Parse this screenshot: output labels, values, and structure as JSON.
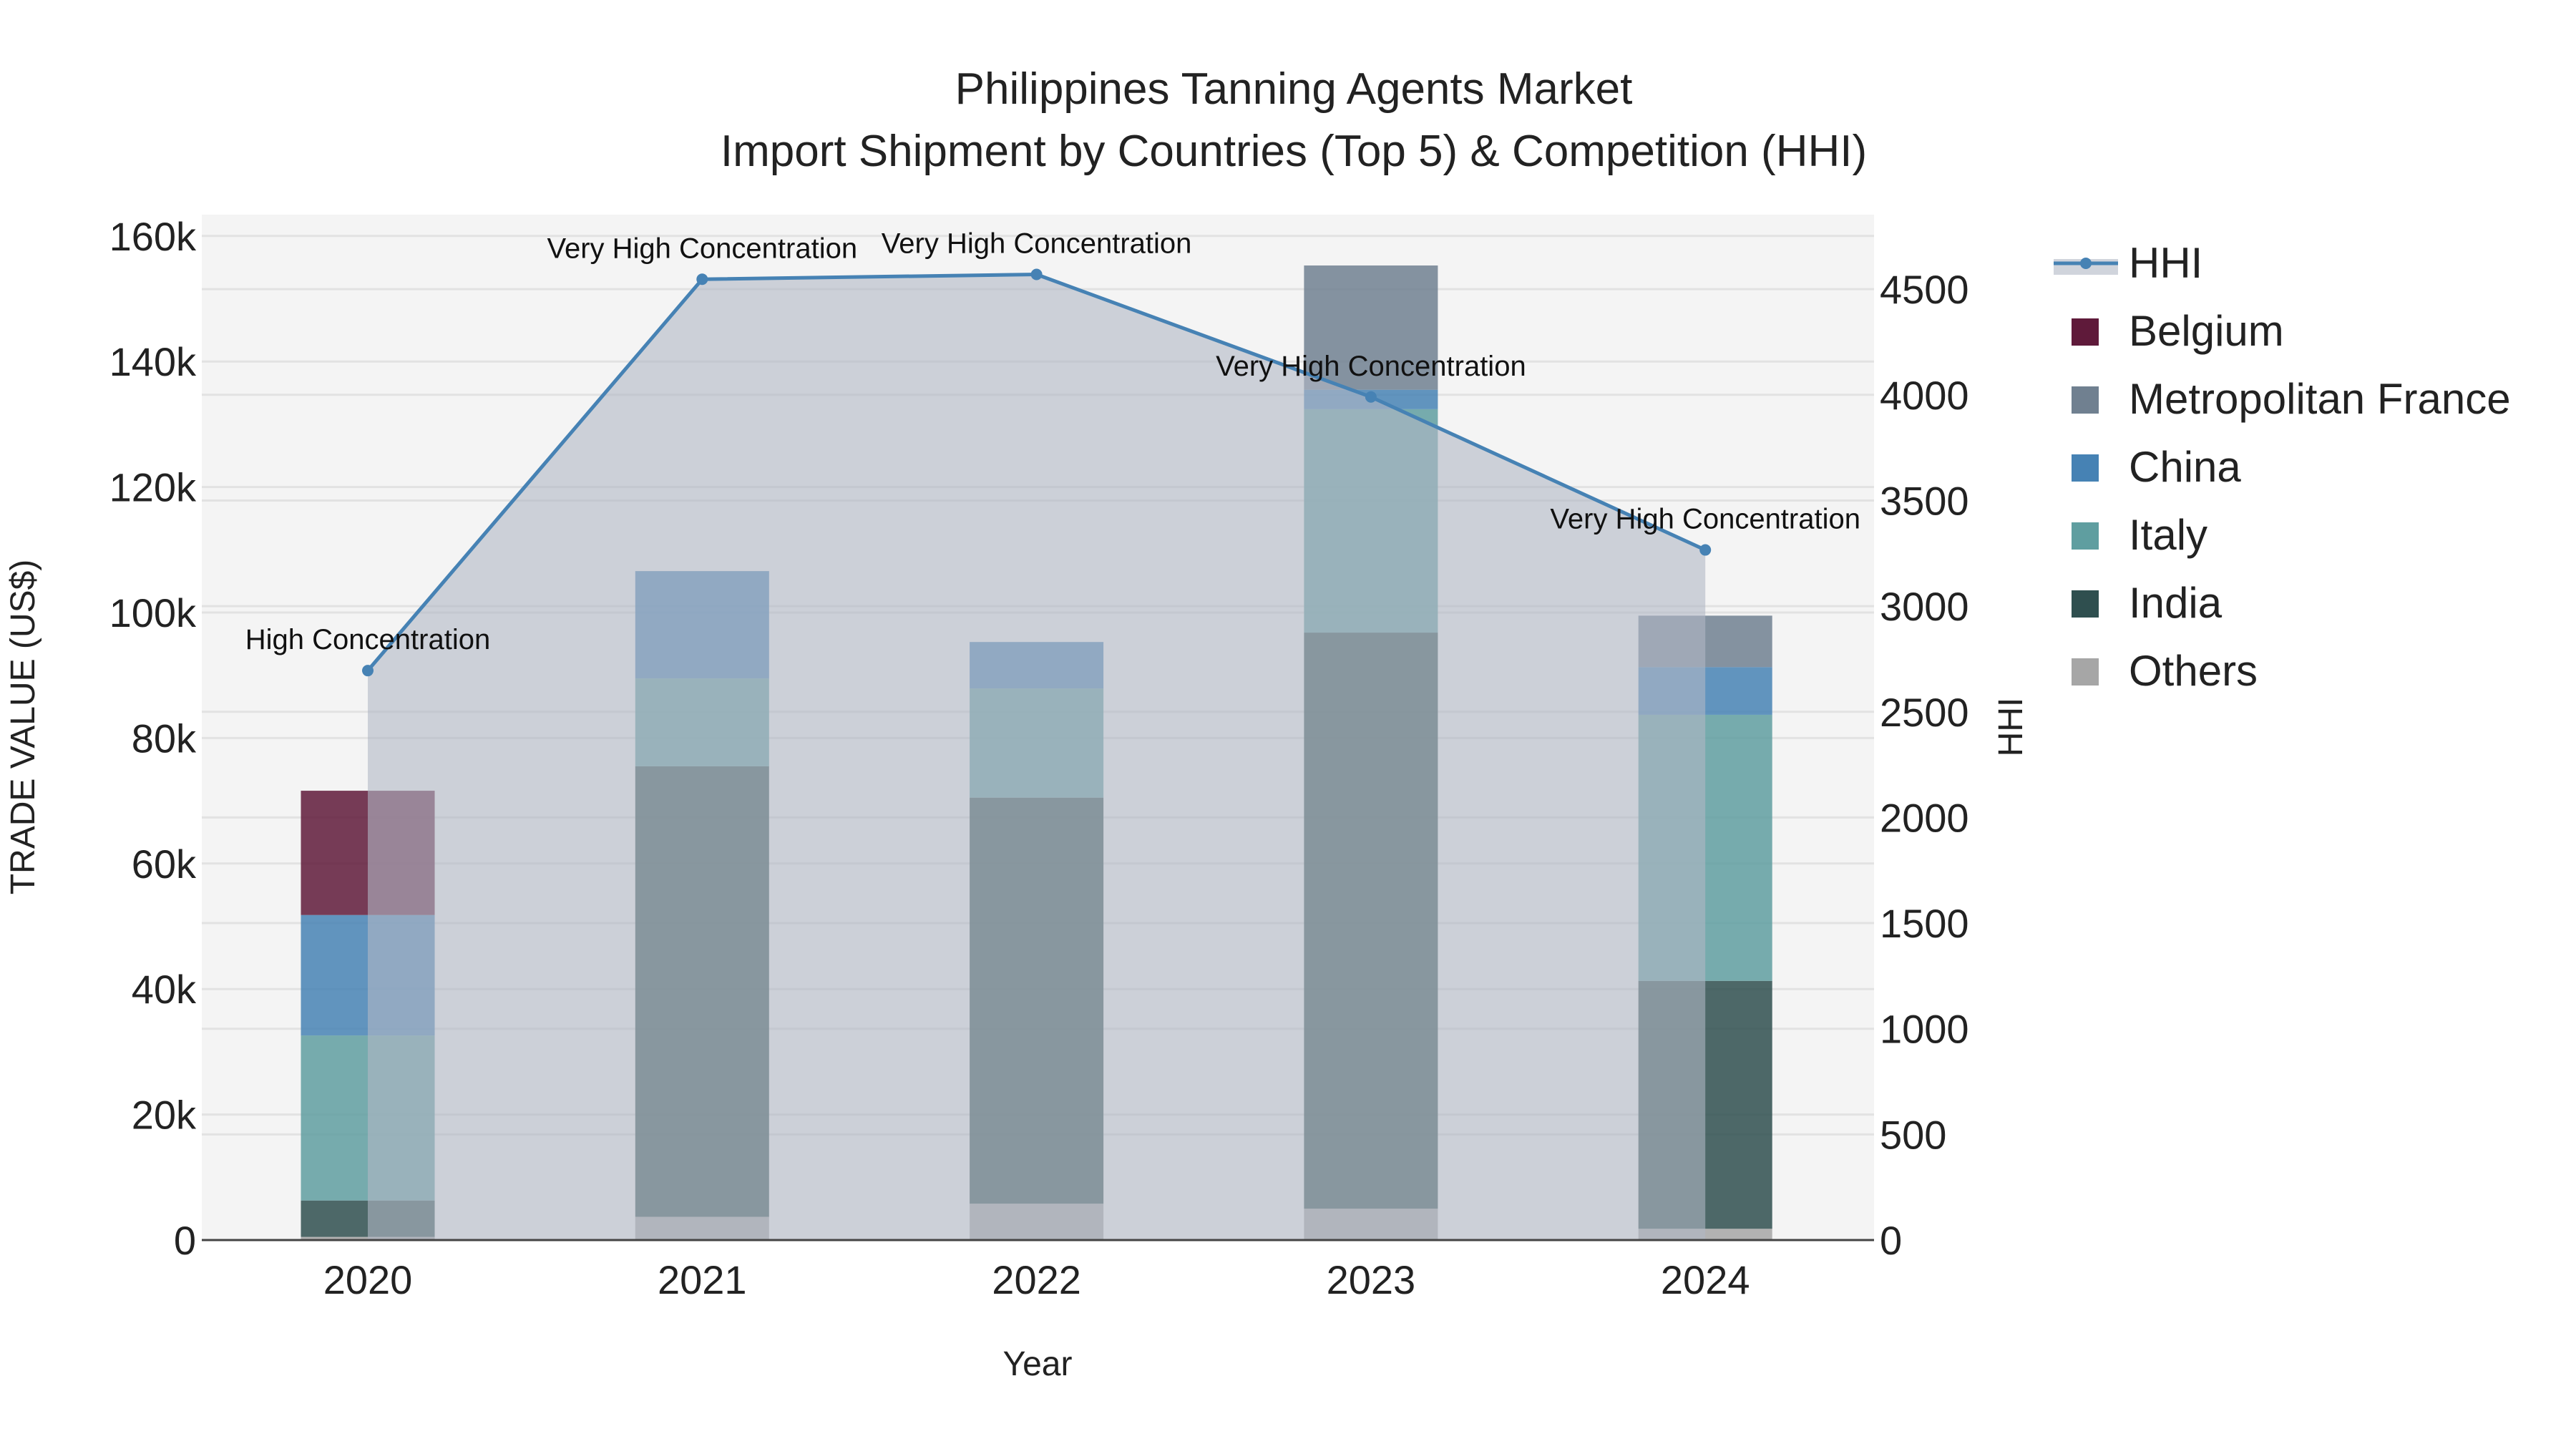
{
  "chart_data": {
    "type": "bar",
    "title_line1": "Philippines Tanning Agents Market",
    "title_line2": "Import Shipment by Countries (Top 5) & Competition (HHI)",
    "xlabel": "Year",
    "ylabel": "TRADE VALUE (US$)",
    "y2label": "HHI",
    "categories": [
      "2020",
      "2021",
      "2022",
      "2023",
      "2024"
    ],
    "ylim": [
      0,
      160000
    ],
    "y_ticks": [
      0,
      20000,
      40000,
      60000,
      80000,
      100000,
      120000,
      140000,
      160000
    ],
    "y_tick_labels": [
      "0",
      "20k",
      "40k",
      "60k",
      "80k",
      "100k",
      "120k",
      "140k",
      "160k"
    ],
    "y2lim": [
      0,
      4725
    ],
    "y2_ticks": [
      0,
      500,
      1000,
      1500,
      2000,
      2500,
      3000,
      3500,
      4000,
      4500
    ],
    "y2_tick_labels": [
      "0",
      "500",
      "1000",
      "1500",
      "2000",
      "2500",
      "3000",
      "3500",
      "4000",
      "4500"
    ],
    "stacked": true,
    "series": [
      {
        "name": "Others",
        "color": "#A6A6A6",
        "values": [
          500,
          3700,
          5800,
          5000,
          1800
        ]
      },
      {
        "name": "India",
        "color": "#2F4F4F",
        "values": [
          5800,
          71800,
          64700,
          91800,
          39500
        ]
      },
      {
        "name": "Italy",
        "color": "#5F9EA0",
        "values": [
          26300,
          14000,
          17400,
          35600,
          42400
        ]
      },
      {
        "name": "China",
        "color": "#4682B4",
        "values": [
          19200,
          17100,
          7400,
          3100,
          7600
        ]
      },
      {
        "name": "Metropolitan France",
        "color": "#708090",
        "values": [
          0,
          0,
          0,
          19800,
          8200
        ]
      },
      {
        "name": "Belgium",
        "color": "#5F1A3A",
        "values": [
          19800,
          0,
          0,
          0,
          0
        ]
      }
    ],
    "legend_order": [
      "HHI",
      "Belgium",
      "Metropolitan France",
      "China",
      "Italy",
      "India",
      "Others"
    ],
    "hhi": {
      "name": "HHI",
      "color": "#4682B4",
      "values": [
        2695,
        4547,
        4570,
        3990,
        3266
      ],
      "labels": [
        "High Concentration",
        "Very High Concentration",
        "Very High Concentration",
        "Very High Concentration",
        "Very High Concentration"
      ]
    },
    "legend_position": "right",
    "grid": true
  }
}
